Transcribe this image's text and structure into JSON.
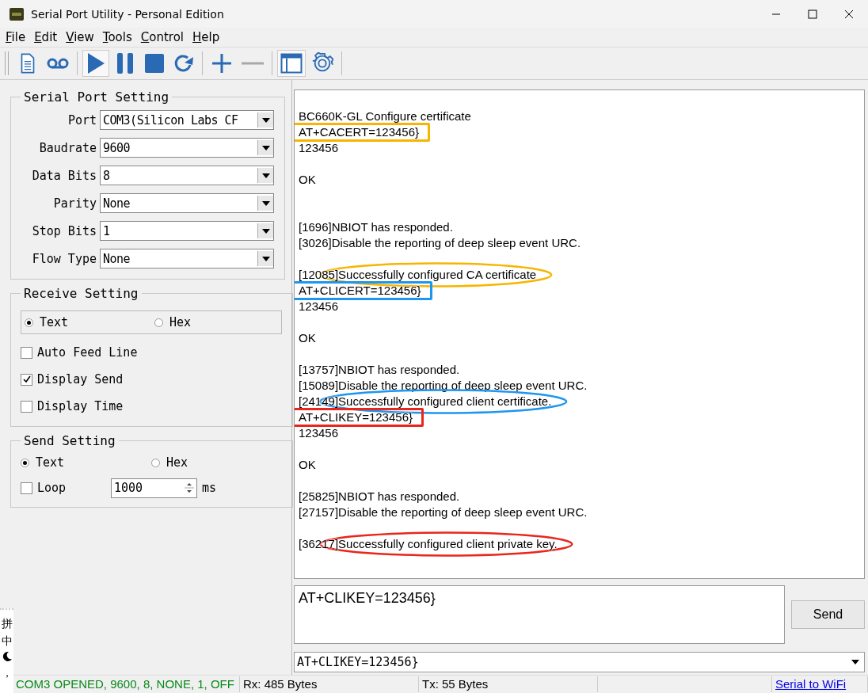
{
  "window": {
    "title": "Serial Port Utility - Personal Edition"
  },
  "menu": [
    {
      "label": "File"
    },
    {
      "label": "Edit"
    },
    {
      "label": "View"
    },
    {
      "label": "Tools"
    },
    {
      "label": "Control"
    },
    {
      "label": "Help"
    }
  ],
  "toolbar": [
    {
      "kind": "document",
      "pressed": false
    },
    {
      "kind": "tape",
      "pressed": false
    },
    {
      "kind": "play",
      "pressed": true
    },
    {
      "kind": "pause",
      "pressed": false
    },
    {
      "kind": "stop",
      "pressed": false
    },
    {
      "kind": "refresh",
      "pressed": false
    },
    {
      "kind": "plus",
      "pressed": false
    },
    {
      "kind": "minus",
      "pressed": false
    },
    {
      "kind": "window",
      "pressed": true
    },
    {
      "kind": "gear",
      "pressed": false
    }
  ],
  "serial_port_setting": {
    "title": "Serial Port Setting",
    "fields": [
      {
        "label": "Port",
        "value": "COM3(Silicon Labs CF"
      },
      {
        "label": "Baudrate",
        "value": "9600"
      },
      {
        "label": "Data Bits",
        "value": "8"
      },
      {
        "label": "Parity",
        "value": "None"
      },
      {
        "label": "Stop Bits",
        "value": "1"
      },
      {
        "label": "Flow Type",
        "value": "None"
      }
    ]
  },
  "receive_setting": {
    "title": "Receive Setting",
    "modes": [
      {
        "label": "Text",
        "selected": true
      },
      {
        "label": "Hex",
        "selected": false
      }
    ],
    "options": [
      {
        "label": "Auto Feed Line",
        "checked": false
      },
      {
        "label": "Display Send",
        "checked": true
      },
      {
        "label": "Display Time",
        "checked": false
      }
    ]
  },
  "send_setting": {
    "title": "Send Setting",
    "modes": [
      {
        "label": "Text",
        "selected": true
      },
      {
        "label": "Hex",
        "selected": false
      }
    ],
    "loop": {
      "label": "Loop",
      "checked": false
    },
    "interval": "1000",
    "unit": "ms"
  },
  "log": {
    "lines": [
      {
        "kind": "blank"
      },
      {
        "kind": "text",
        "text": "BC660K-GL Configure certificate"
      },
      {
        "kind": "text",
        "text": "AT+CACERT=123456}",
        "mark": {
          "kind": "box",
          "color": "#f7b500"
        }
      },
      {
        "kind": "text",
        "text": "123456"
      },
      {
        "kind": "blank"
      },
      {
        "kind": "text",
        "text": "OK"
      },
      {
        "kind": "blank"
      },
      {
        "kind": "blank"
      },
      {
        "kind": "text",
        "text": "[1696]NBIOT has responded."
      },
      {
        "kind": "text",
        "text": "[3026]Disable the reporting of deep sleep event URC."
      },
      {
        "kind": "blank"
      },
      {
        "kind": "text",
        "text": "[12085]Successfully configured CA certificate",
        "mark": {
          "kind": "ellipse",
          "color": "#f7b500"
        }
      },
      {
        "kind": "text",
        "text": "AT+CLICERT=123456}",
        "mark": {
          "kind": "box",
          "color": "#1e96f0"
        }
      },
      {
        "kind": "text",
        "text": "123456"
      },
      {
        "kind": "blank"
      },
      {
        "kind": "text",
        "text": "OK"
      },
      {
        "kind": "blank"
      },
      {
        "kind": "text",
        "text": "[13757]NBIOT has responded."
      },
      {
        "kind": "text",
        "text": "[15089]Disable the reporting of deep sleep event URC."
      },
      {
        "kind": "text",
        "text": "[24149]Successfully configured client certificate.",
        "mark": {
          "kind": "ellipse",
          "color": "#1e96f0"
        }
      },
      {
        "kind": "text",
        "text": "AT+CLIKEY=123456}",
        "mark": {
          "kind": "box",
          "color": "#e8261c"
        }
      },
      {
        "kind": "text",
        "text": "123456"
      },
      {
        "kind": "blank"
      },
      {
        "kind": "text",
        "text": "OK"
      },
      {
        "kind": "blank"
      },
      {
        "kind": "text",
        "text": "[25825]NBIOT has responded."
      },
      {
        "kind": "text",
        "text": "[27157]Disable the reporting of deep sleep event URC."
      },
      {
        "kind": "blank"
      },
      {
        "kind": "text",
        "text": "[36217]Successfully configured client private key.",
        "mark": {
          "kind": "ellipse",
          "color": "#e8261c"
        }
      }
    ]
  },
  "send_input": {
    "value": "AT+CLIKEY=123456}"
  },
  "send_button": {
    "label": "Send"
  },
  "history_combo": {
    "value": "AT+CLIKEY=123456}"
  },
  "status_bar": {
    "connection": "COM3 OPENED, 9600, 8, NONE, 1, OFF",
    "rx": "Rx: 485 Bytes",
    "tx": "Tx: 55 Bytes",
    "link": "Serial to WiFi"
  },
  "ime_bar": {
    "items": [
      {
        "kind": "text",
        "label": "拼"
      },
      {
        "kind": "text",
        "label": "中"
      },
      {
        "kind": "moon"
      },
      {
        "kind": "text",
        "label": "，"
      }
    ]
  }
}
